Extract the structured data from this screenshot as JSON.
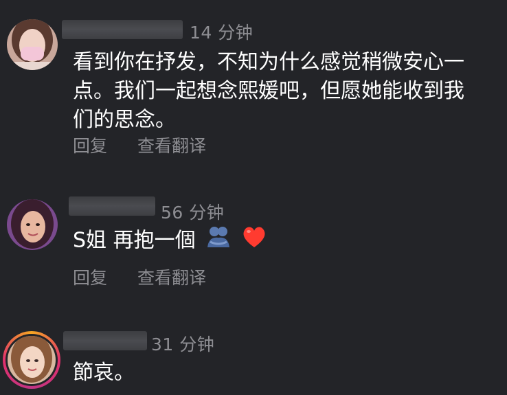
{
  "comments": [
    {
      "time": "14 分钟",
      "lines": [
        "看到你在抒发，不知为什么感觉稍微安心一",
        "点。我们一起想念熙媛吧，但愿她能收到我",
        "们的思念。"
      ],
      "reply": "回复",
      "translate": "查看翻译"
    },
    {
      "time": "56 分钟",
      "text": "S姐 再抱一個",
      "emojis": [
        "hugging-people-icon",
        "red-heart-icon"
      ],
      "reply": "回复",
      "translate": "查看翻译"
    },
    {
      "time": "31 分钟",
      "text": "節哀。"
    }
  ],
  "colors": {
    "background": "#232428",
    "text": "#ffffff",
    "secondary": "#8e8e93",
    "heart": "#ff3b30"
  }
}
